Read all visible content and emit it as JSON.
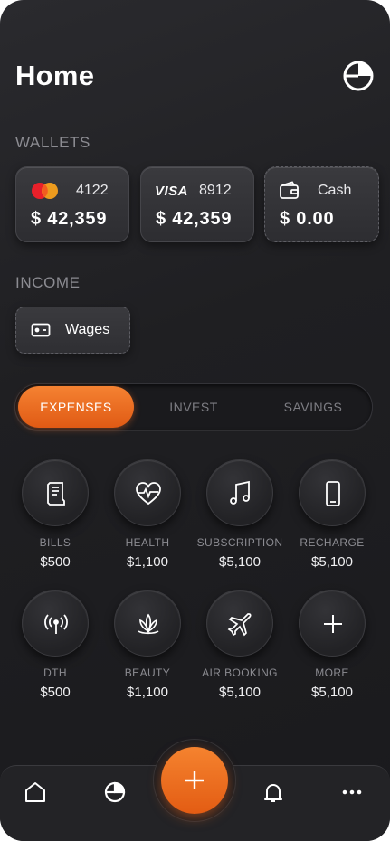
{
  "header": {
    "title": "Home"
  },
  "wallets": {
    "label": "WALLETS",
    "cards": [
      {
        "brand": "mastercard",
        "number": "4122",
        "amount": "$ 42,359"
      },
      {
        "brand": "VISA",
        "number": "8912",
        "amount": "$ 42,359"
      },
      {
        "brand": "wallet-icon",
        "number": "Cash",
        "amount": "$ 0.00"
      }
    ]
  },
  "income": {
    "label": "INCOME",
    "item": "Wages"
  },
  "tabs": [
    "EXPENSES",
    "INVEST",
    "SAVINGS"
  ],
  "active_tab": "EXPENSES",
  "categories": [
    {
      "icon": "receipt-icon",
      "name": "BILLS",
      "value": "$500"
    },
    {
      "icon": "heart-pulse-icon",
      "name": "HEALTH",
      "value": "$1,100"
    },
    {
      "icon": "music-note-icon",
      "name": "SUBSCRIPTION",
      "value": "$5,100"
    },
    {
      "icon": "smartphone-icon",
      "name": "RECHARGE",
      "value": "$5,100"
    },
    {
      "icon": "antenna-icon",
      "name": "DTH",
      "value": "$500"
    },
    {
      "icon": "lotus-icon",
      "name": "BEAUTY",
      "value": "$1,100"
    },
    {
      "icon": "airplane-icon",
      "name": "AIR BOOKING",
      "value": "$5,100"
    },
    {
      "icon": "plus-icon",
      "name": "MORE",
      "value": "$5,100"
    }
  ],
  "nav": [
    "home-icon",
    "pie-chart-icon",
    "add-icon",
    "bell-icon",
    "more-icon"
  ],
  "colors": {
    "accent": "#F07A2C",
    "background": "#1F1F22",
    "muted": "#8C8C92"
  }
}
